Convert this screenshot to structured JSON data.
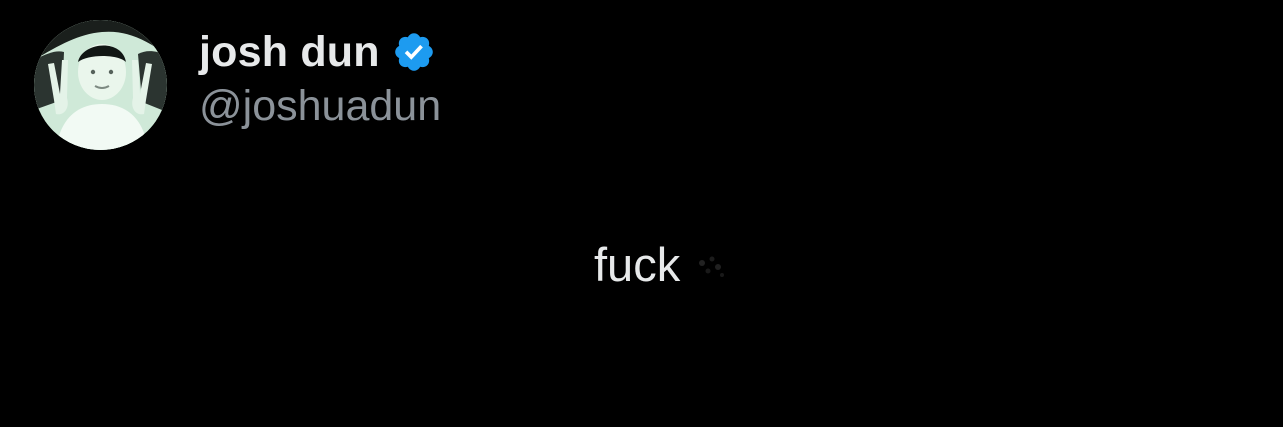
{
  "tweet": {
    "author": {
      "display_name": "josh dun",
      "handle": "@joshuadun",
      "verified": true,
      "avatar_icon": "profile-photo-avatar",
      "verified_icon": "verified-badge-icon"
    },
    "text": "fuck"
  },
  "colors": {
    "background": "#000000",
    "name_text": "#e7e9ea",
    "handle_text": "#8b9299",
    "verified_badge": "#1d9bf0"
  }
}
